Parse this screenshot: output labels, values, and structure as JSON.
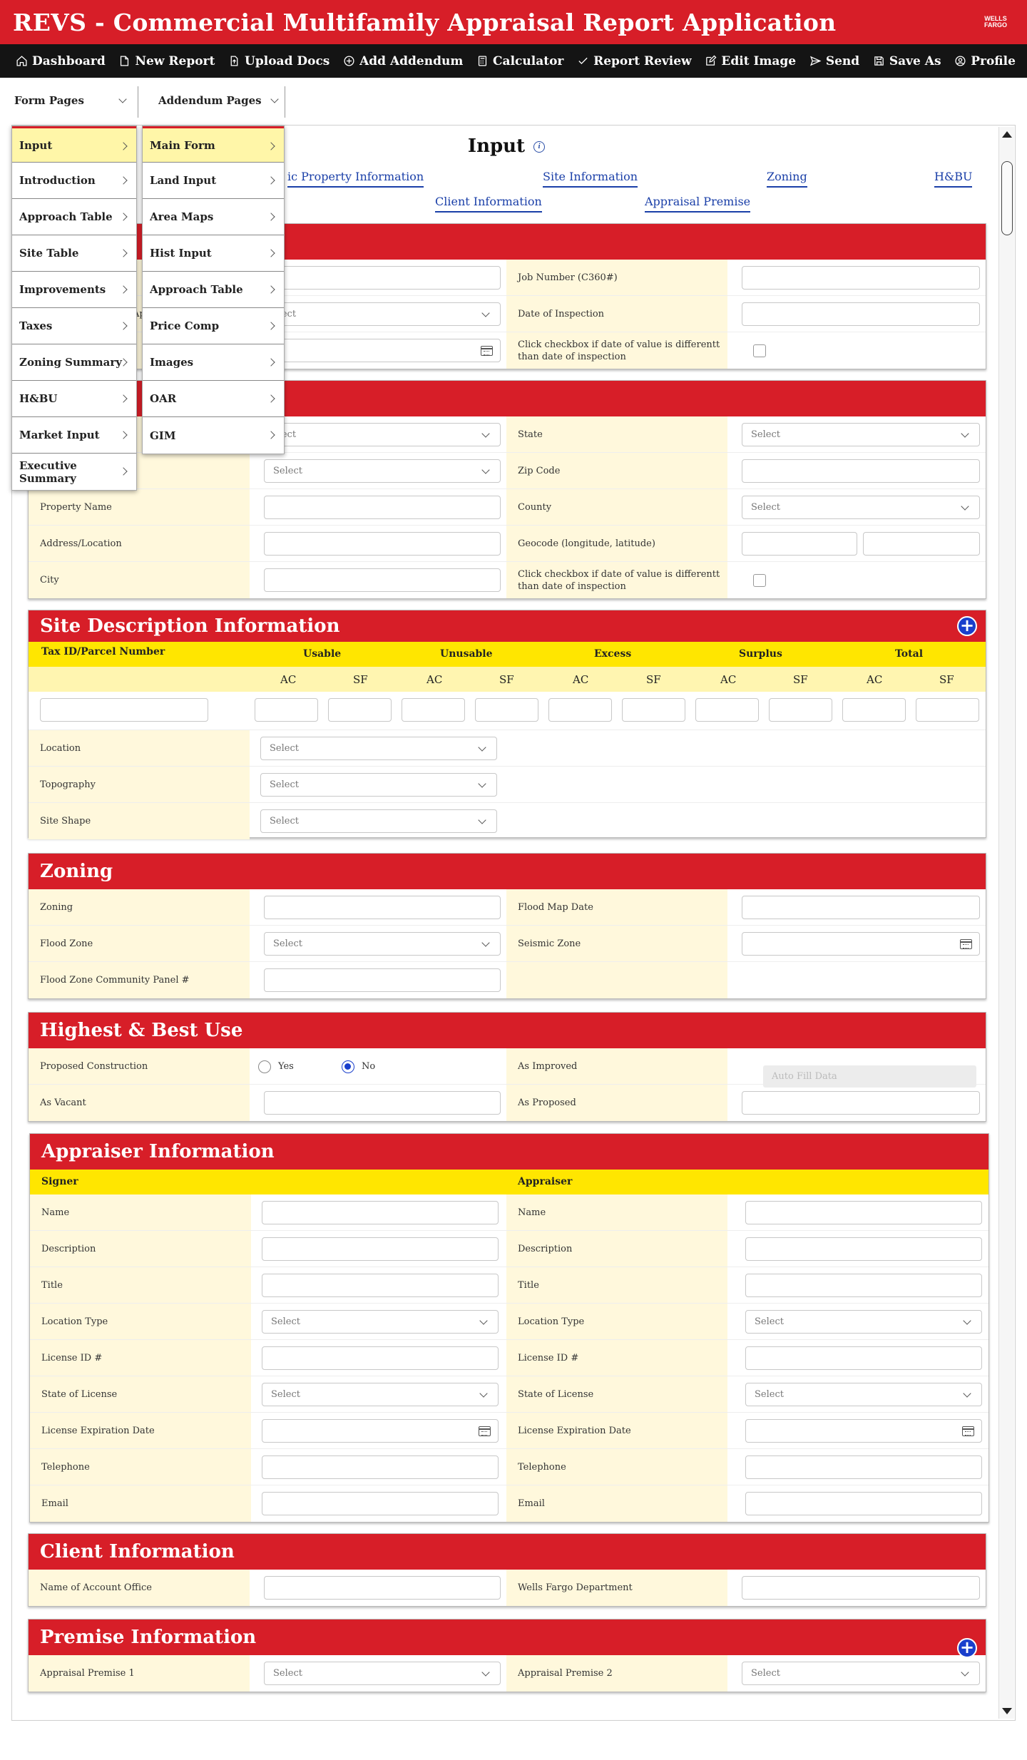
{
  "app": {
    "title": "REVS - Commercial Multifamily Appraisal Report Application",
    "logo_line1": "WELLS",
    "logo_line2": "FARGO",
    "brand_red": "#d71e28",
    "accent_blue": "#1a3fa8",
    "label_bg": "#fff8dc",
    "header_yellow": "#ffe600"
  },
  "nav": [
    {
      "label": "Dashboard",
      "icon": "home-icon"
    },
    {
      "label": "New Report",
      "icon": "document-icon"
    },
    {
      "label": "Upload Docs",
      "icon": "upload-icon"
    },
    {
      "label": "Add Addendum",
      "icon": "plus-circle-icon"
    },
    {
      "label": "Calculator",
      "icon": "calculator-icon"
    },
    {
      "label": "Report Review",
      "icon": "check-icon"
    },
    {
      "label": "Edit Image",
      "icon": "edit-icon"
    },
    {
      "label": "Send",
      "icon": "send-icon"
    },
    {
      "label": "Save As",
      "icon": "save-icon"
    },
    {
      "label": "Profile",
      "icon": "user-icon"
    }
  ],
  "pages": {
    "form_pages": "Form Pages",
    "addendum_pages": "Addendum Pages"
  },
  "form_menu": [
    "Input",
    "Introduction",
    "Approach Table",
    "Site Table",
    "Improvements",
    "Taxes",
    "Zoning Summary",
    "H&BU",
    "Market Input",
    "Executive Summary"
  ],
  "addendum_menu": [
    "Main Form",
    "Land Input",
    "Area Maps",
    "Hist Input",
    "Approach Table",
    "Price Comp",
    "Images",
    "OAR",
    "GIM"
  ],
  "page": {
    "heading": "Input"
  },
  "sublinks": {
    "property": "ic Property Information",
    "site": "Site Information",
    "zoning": "Zoning",
    "hbu": "H&BU",
    "client": "Client Information",
    "premise": "Appraisal Premise"
  },
  "sec1": {
    "job_label": "Job Number (C360#)",
    "insp_label": "Date of Inspection",
    "checkbox_label": "Click checkbox if date of value is differentt than date of inspection",
    "select": "elect",
    "partial_letter": "Ap"
  },
  "sec2": {
    "state": "State",
    "zip": "Zip Code",
    "county": "County",
    "property_name": "Property Name",
    "address": "Address/Location",
    "geocode": "Geocode (longitude, latitude)",
    "city": "City",
    "checkbox_label": "Click checkbox if date of value is differentt than date of inspection",
    "select": "Select",
    "select_partial": "elect"
  },
  "site_desc": {
    "title": "Site Description Information",
    "tax_id": "Tax ID/Parcel Number",
    "groups": [
      "Usable",
      "Unusable",
      "Excess",
      "Surplus",
      "Total"
    ],
    "units": [
      "AC",
      "SF",
      "AC",
      "SF",
      "AC",
      "SF",
      "AC",
      "SF",
      "AC",
      "SF"
    ],
    "location": "Location",
    "topography": "Topography",
    "site_shape": "Site Shape",
    "select": "Select"
  },
  "zoning": {
    "title": "Zoning",
    "zoning": "Zoning",
    "flood_map": "Flood Map Date",
    "flood_zone": "Flood Zone",
    "seismic": "Seismic Zone",
    "panel": "Flood Zone Community Panel #",
    "select": "Select"
  },
  "hbu": {
    "title": "Highest & Best Use",
    "proposed": "Proposed Construction",
    "yes": "Yes",
    "no": "No",
    "as_improved": "As Improved",
    "autofill": "Auto Fill Data",
    "as_vacant": "As Vacant",
    "as_proposed": "As Proposed",
    "selected": "No"
  },
  "appraiser": {
    "title": "Appraiser Information",
    "signer": "Signer",
    "appraiser": "Appraiser",
    "fields": [
      "Name",
      "Description",
      "Title",
      "Location Type",
      "License ID #",
      "State of License",
      "License Expiration Date",
      "Telephone",
      "Email"
    ],
    "select": "Select"
  },
  "client": {
    "title": "Client Information",
    "office": "Name of Account Office",
    "dept": "Wells Fargo Department"
  },
  "premise": {
    "title": "Premise Information",
    "p1": "Appraisal Premise 1",
    "p2": "Appraisal Premise 2",
    "select": "Select"
  }
}
